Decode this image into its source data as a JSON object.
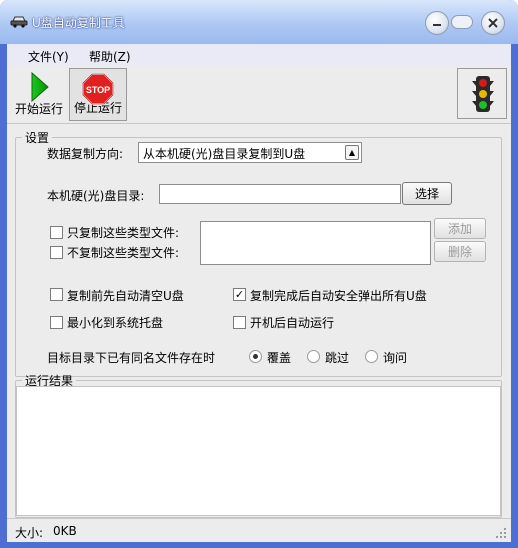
{
  "window": {
    "title": "U盘自动复制工具"
  },
  "menu": {
    "file": "文件(Y)",
    "help": "帮助(Z)"
  },
  "toolbar": {
    "start_label": "开始运行",
    "stop_label": "停止运行",
    "stop_sign_text": "STOP"
  },
  "settings": {
    "group_title": "设置",
    "direction_label": "数据复制方向:",
    "direction_value": "从本机硬(光)盘目录复制到U盘",
    "local_dir_label": "本机硬(光)盘目录:",
    "local_dir_value": "",
    "browse_button": "选择",
    "only_copy_label": "只复制这些类型文件:",
    "only_copy_checked": false,
    "no_copy_label": "不复制这些类型文件:",
    "no_copy_checked": false,
    "file_types_value": "",
    "add_button": "添加",
    "delete_button": "删除",
    "clear_before_label": "复制前先自动清空U盘",
    "clear_before_checked": false,
    "eject_after_label": "复制完成后自动安全弹出所有U盘",
    "eject_after_checked": true,
    "minimize_tray_label": "最小化到系统托盘",
    "minimize_tray_checked": false,
    "autorun_label": "开机后自动运行",
    "autorun_checked": false,
    "conflict_label": "目标目录下已有同名文件存在时",
    "conflict_options": [
      "覆盖",
      "跳过",
      "询问"
    ],
    "conflict_selected": "覆盖"
  },
  "results": {
    "group_title": "运行结果"
  },
  "status": {
    "size_label": "大小:",
    "size_value": "0KB"
  }
}
